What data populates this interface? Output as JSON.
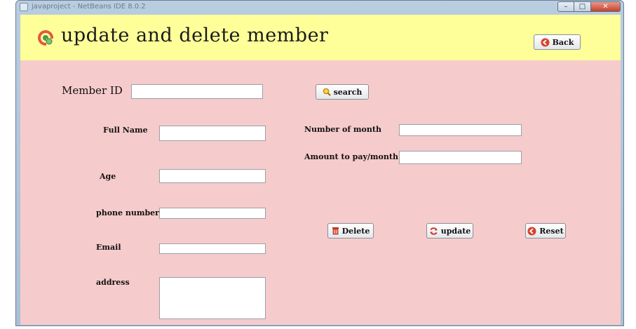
{
  "window": {
    "title": "javaproject - NetBeans IDE 8.0.2",
    "controls": {
      "minimize": "–",
      "maximize": "□",
      "close": "✕"
    }
  },
  "header": {
    "title": "update and delete member",
    "back_label": "Back",
    "logo_icon": "gear-icon",
    "back_icon": "arrow-left-icon",
    "bg_color": "#ffff9a"
  },
  "form": {
    "member_id": {
      "label": "Member ID",
      "value": ""
    },
    "search_label": "search",
    "full_name": {
      "label": "Full Name",
      "value": ""
    },
    "age": {
      "label": "Age",
      "value": ""
    },
    "phone": {
      "label": "phone number",
      "value": ""
    },
    "email": {
      "label": "Email",
      "value": ""
    },
    "address": {
      "label": "address",
      "value": ""
    },
    "months": {
      "label": "Number of month",
      "value": ""
    },
    "amount": {
      "label": "Amount to pay/month",
      "value": ""
    }
  },
  "actions": {
    "delete_label": "Delete",
    "update_label": "update",
    "reset_label": "Reset"
  },
  "colors": {
    "panel_bg": "#f6cbcb",
    "header_bg": "#ffff9a"
  }
}
